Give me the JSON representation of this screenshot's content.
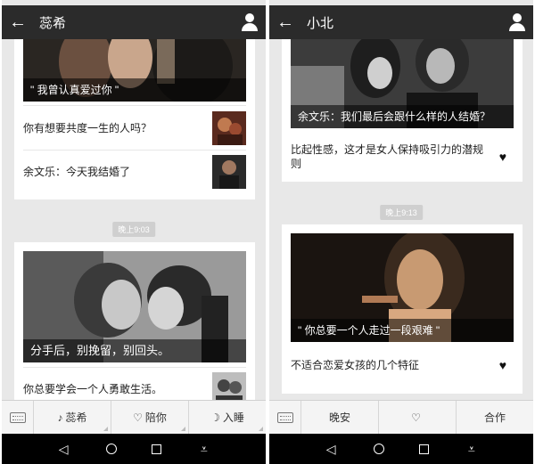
{
  "left_screen": {
    "header": {
      "back_icon": "arrow-left-icon",
      "title": "蕊希",
      "profile_icon": "person-icon"
    },
    "card1": {
      "caption": "\" 我曾认真爱过你 \"",
      "rows": [
        {
          "text": "你有想要共度一生的人吗？"
        },
        {
          "text": "余文乐：今天我结婚了"
        }
      ]
    },
    "timestamp": "晚上9:03",
    "card2": {
      "caption": "分手后，别挽留，别回头。",
      "rows": [
        {
          "text": "你总要学会一个人勇敢生活。"
        }
      ]
    },
    "menu": {
      "keyboard_icon": "keyboard-icon",
      "items": [
        {
          "icon": "♪",
          "label": "蕊希"
        },
        {
          "icon": "♡",
          "label": "陪你"
        },
        {
          "icon": "☽",
          "label": "入睡"
        }
      ]
    }
  },
  "right_screen": {
    "header": {
      "back_icon": "arrow-left-icon",
      "title": "小北",
      "profile_icon": "person-icon"
    },
    "card1": {
      "caption": "余文乐：我们最后会跟什么样的人结婚？",
      "rows": [
        {
          "text": "比起性感，这才是女人保持吸引力的潜规则",
          "heart": "♥"
        }
      ]
    },
    "timestamp": "晚上9:13",
    "card2": {
      "caption": "\" 你总要一个人走过一段艰难 \"",
      "rows": [
        {
          "text": "不适合恋爱女孩的几个特征",
          "heart": "♥"
        }
      ]
    },
    "menu": {
      "keyboard_icon": "keyboard-icon",
      "items": [
        {
          "icon": "",
          "label": "晚安"
        },
        {
          "icon": "♡",
          "label": ""
        },
        {
          "icon": "",
          "label": "合作"
        }
      ]
    }
  },
  "navbar": {
    "back": "◁",
    "home_icon": "circle-home-icon",
    "recent_icon": "square-recent-icon",
    "menu": "⩡"
  }
}
